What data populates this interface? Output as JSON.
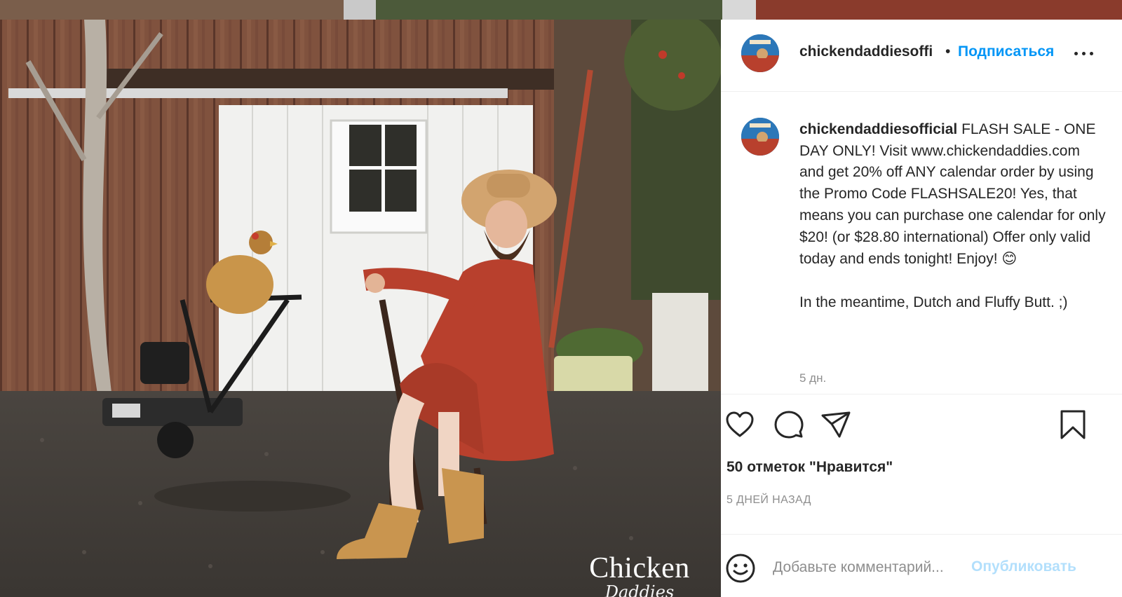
{
  "post": {
    "header": {
      "username": "chickendaddiesoffi",
      "separator": "•",
      "follow_label": "Подписаться"
    },
    "caption": {
      "username": "chickendaddiesofficial",
      "text": " FLASH SALE - ONE DAY ONLY! Visit www.chickendaddies.com and get 20% off ANY calendar order by using the Promo Code FLASHSALE20! Yes, that means you can purchase one calendar for only $20! (or $28.80 international) Offer only valid today and ends tonight! Enjoy! ",
      "emoji": "😊",
      "text_after": "\n\nIn the meantime, Dutch and Fluffy Butt. ;)",
      "age": "5 дн."
    },
    "likes_label": "50 отметок \"Нравится\"",
    "date_label": "5 ДНЕЙ НАЗАД",
    "add_comment": {
      "placeholder": "Добавьте комментарий...",
      "publish_label": "Опубликовать"
    }
  },
  "photo": {
    "watermark_line1": "Chicken",
    "watermark_line2": "Daddies"
  },
  "icons": {
    "like": "heart-outline-icon",
    "comment": "speech-bubble-icon",
    "share": "paper-plane-icon",
    "save": "bookmark-icon",
    "more": "three-dots-icon",
    "emoji": "smiley-face-icon"
  },
  "colors": {
    "link_blue": "#0095f6",
    "publish_disabled": "#b2dffc",
    "text_primary": "#262626",
    "text_secondary": "#8e8e8e",
    "divider": "#efefef"
  }
}
